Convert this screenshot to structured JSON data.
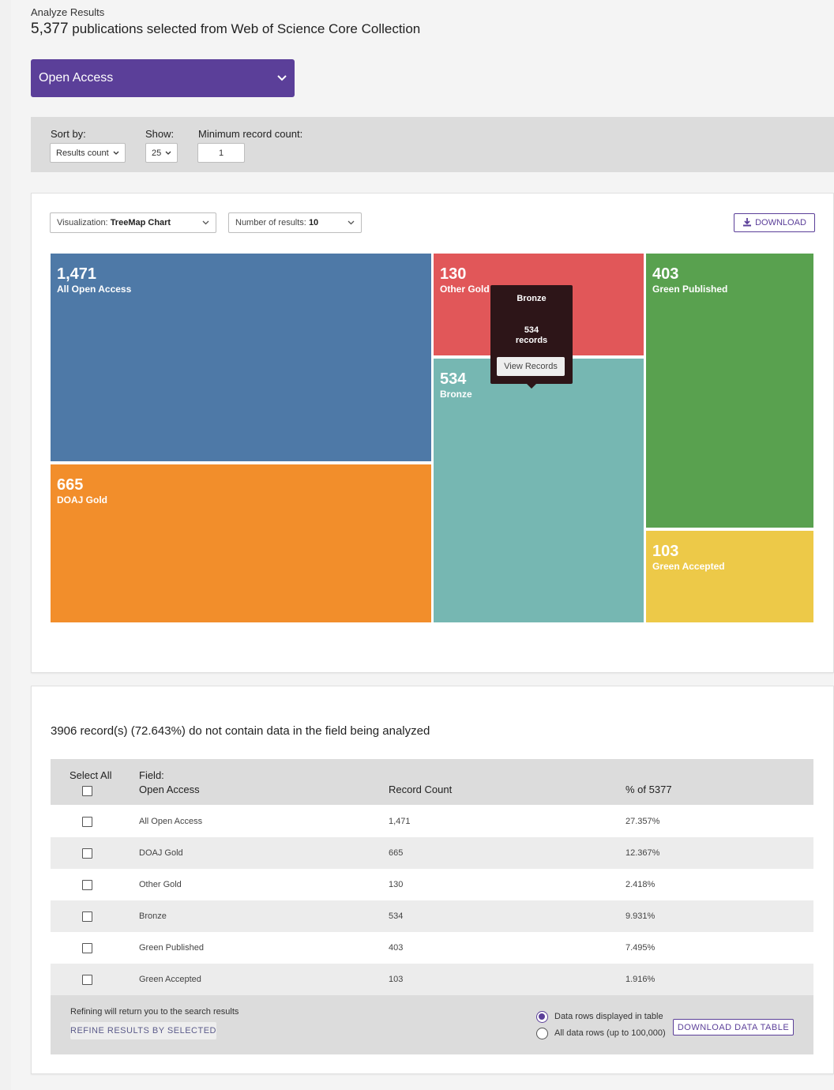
{
  "header": {
    "breadcrumb": "Analyze Results",
    "count": "5,377",
    "summary": "publications selected from Web of Science Core Collection"
  },
  "field_selector": {
    "label": "Open Access",
    "icon": "chevron-down-icon"
  },
  "filters": {
    "sort_label": "Sort by:",
    "sort_value": "Results count",
    "show_label": "Show:",
    "show_value": "25",
    "min_label": "Minimum record count:",
    "min_value": "1"
  },
  "chart_controls": {
    "viz_prefix": "Visualization:",
    "viz_value": "TreeMap Chart",
    "num_prefix": "Number of results:",
    "num_value": "10",
    "download_label": "DOWNLOAD"
  },
  "chart_data": {
    "type": "treemap",
    "items": [
      {
        "label": "All Open Access",
        "value": "1,471",
        "color": "#4e79a7"
      },
      {
        "label": "DOAJ Gold",
        "value": "665",
        "color": "#f28e2b"
      },
      {
        "label": "Other Gold",
        "value": "130",
        "color": "#e15759"
      },
      {
        "label": "Bronze",
        "value": "534",
        "color": "#76b7b2"
      },
      {
        "label": "Green Published",
        "value": "403",
        "color": "#59a14f"
      },
      {
        "label": "Green Accepted",
        "value": "103",
        "color": "#edc948"
      }
    ]
  },
  "tooltip": {
    "title": "Bronze",
    "count": "534",
    "unit": "records",
    "button": "View Records"
  },
  "missing_note": "3906 record(s) (72.643%) do not contain data in the field being analyzed",
  "table": {
    "select_all": "Select All",
    "field_label": "Field:",
    "field_name": "Open Access",
    "col_count": "Record Count",
    "col_pct": "% of 5377",
    "rows": [
      {
        "name": "All Open Access",
        "count": "1,471",
        "pct": "27.357%"
      },
      {
        "name": "DOAJ Gold",
        "count": "665",
        "pct": "12.367%"
      },
      {
        "name": "Other Gold",
        "count": "130",
        "pct": "2.418%"
      },
      {
        "name": "Bronze",
        "count": "534",
        "pct": "9.931%"
      },
      {
        "name": "Green Published",
        "count": "403",
        "pct": "7.495%"
      },
      {
        "name": "Green Accepted",
        "count": "103",
        "pct": "1.916%"
      }
    ]
  },
  "footer": {
    "refine_note": "Refining will return you to the search results",
    "refine_button": "REFINE RESULTS BY SELECTED",
    "radio_displayed": "Data rows displayed in table",
    "radio_all": "All data rows (up to 100,000)",
    "download_table": "DOWNLOAD DATA TABLE"
  },
  "colors": {
    "accent": "#5b3f99"
  }
}
